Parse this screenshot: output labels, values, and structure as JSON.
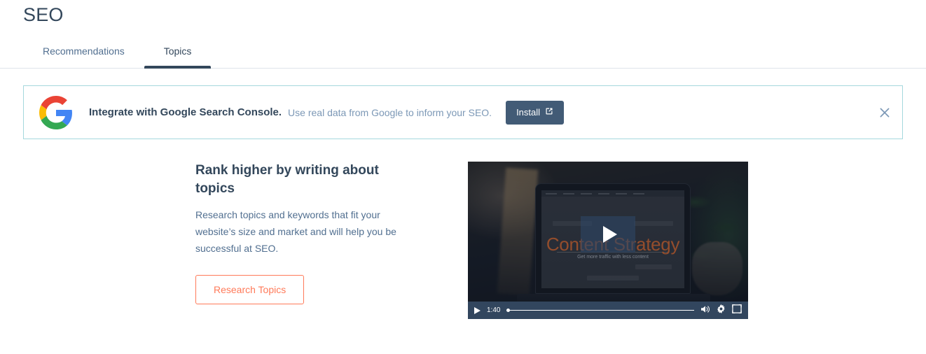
{
  "header": {
    "title": "SEO",
    "tabs": [
      {
        "label": "Recommendations",
        "active": false
      },
      {
        "label": "Topics",
        "active": true
      }
    ]
  },
  "banner": {
    "logo_icon": "google-logo-icon",
    "headline": "Integrate with Google Search Console.",
    "description": "Use real data from Google to inform your SEO.",
    "install_label": "Install",
    "install_icon": "external-link-icon",
    "close_icon": "close-icon",
    "border_color": "#a5d8dd",
    "install_bg_color": "#425b76"
  },
  "promo": {
    "heading": "Rank higher by writing about topics",
    "body": "Research topics and keywords that fit your website’s size and market and will help you be successful at SEO.",
    "cta_label": "Research Topics",
    "cta_color": "#ff7a59"
  },
  "video": {
    "poster_title": "Content Strategy",
    "poster_subtitle": "Get more traffic with less content",
    "play_icon": "play-icon",
    "controls": {
      "play_icon": "play-icon",
      "time": "1:40",
      "volume_icon": "volume-icon",
      "settings_icon": "gear-icon",
      "fullscreen_icon": "fullscreen-icon"
    }
  },
  "colors": {
    "text_primary": "#33475b",
    "text_muted": "#516f90",
    "accent": "#ff7a59",
    "google_blue": "#4285f4",
    "google_red": "#ea4335",
    "google_yellow": "#fbbc05",
    "google_green": "#34a853"
  }
}
